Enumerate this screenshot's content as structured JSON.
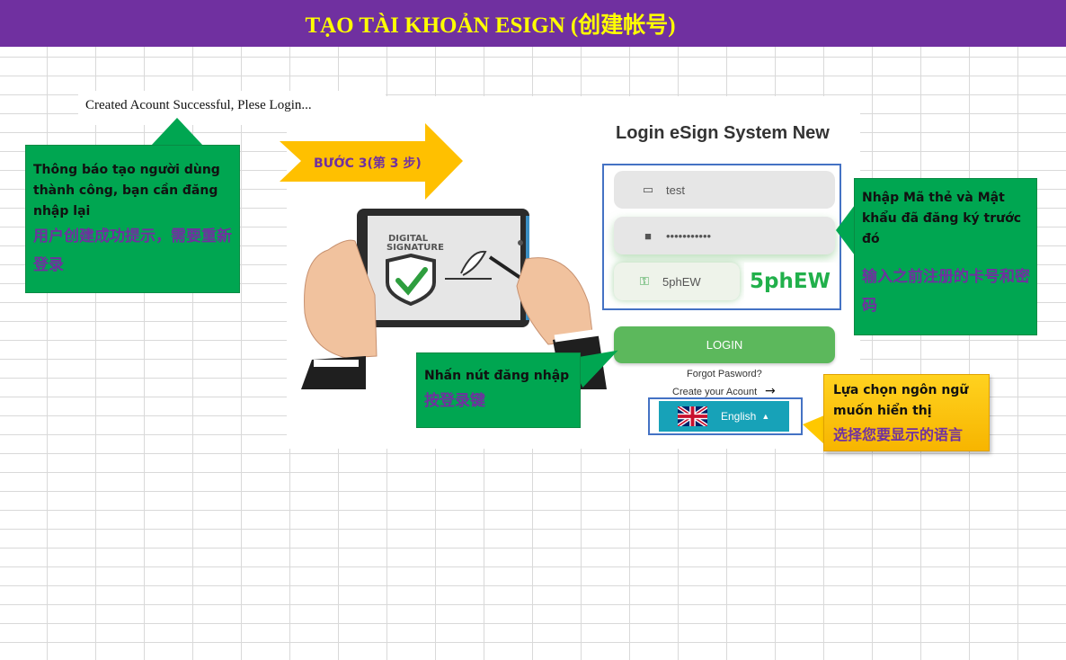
{
  "header": {
    "title": "TẠO TÀI KHOẢN ESIGN (创建帐号)"
  },
  "notice": {
    "message": "Created Acount Successful, Plese Login..."
  },
  "step": {
    "label": "BƯỚC 3(第 3 步)"
  },
  "illustration": {
    "tablet_text_line1": "DIGITAL",
    "tablet_text_line2": "SIGNATURE"
  },
  "login": {
    "title": "Login eSign System New",
    "username_value": "test",
    "password_value": "•••••••••••",
    "captcha_input_value": "5phEW",
    "captcha_image_text": "5phEW",
    "login_button": "LOGIN",
    "forgot_password": "Forgot Pasword?",
    "create_account": "Create your Acount",
    "language": {
      "selected": "English"
    }
  },
  "callouts": {
    "success": {
      "vi": "Thông báo tạo người dùng thành công, bạn cần đăng nhập lại",
      "zh": "用户创建成功提示，需要重新登录"
    },
    "credentials": {
      "vi": "Nhập  Mã thẻ và Mật khẩu đã đăng ký trước đó",
      "zh": "输入之前注册的卡号和密码"
    },
    "login_button": {
      "vi": "Nhấn nút đăng nhập",
      "zh": "按登录键"
    },
    "language": {
      "vi": "Lựa chọn ngôn ngữ muốn hiển thị",
      "zh": "选择您要显示的语言"
    }
  },
  "colors": {
    "header_bg": "#7030a0",
    "header_text": "#ffff00",
    "callout_green": "#00a651",
    "callout_yellow": "#ffc000",
    "accent_purple": "#7030a0",
    "login_button": "#5cb85c",
    "language_button": "#17a2b8",
    "highlight_border": "#4472c4"
  }
}
